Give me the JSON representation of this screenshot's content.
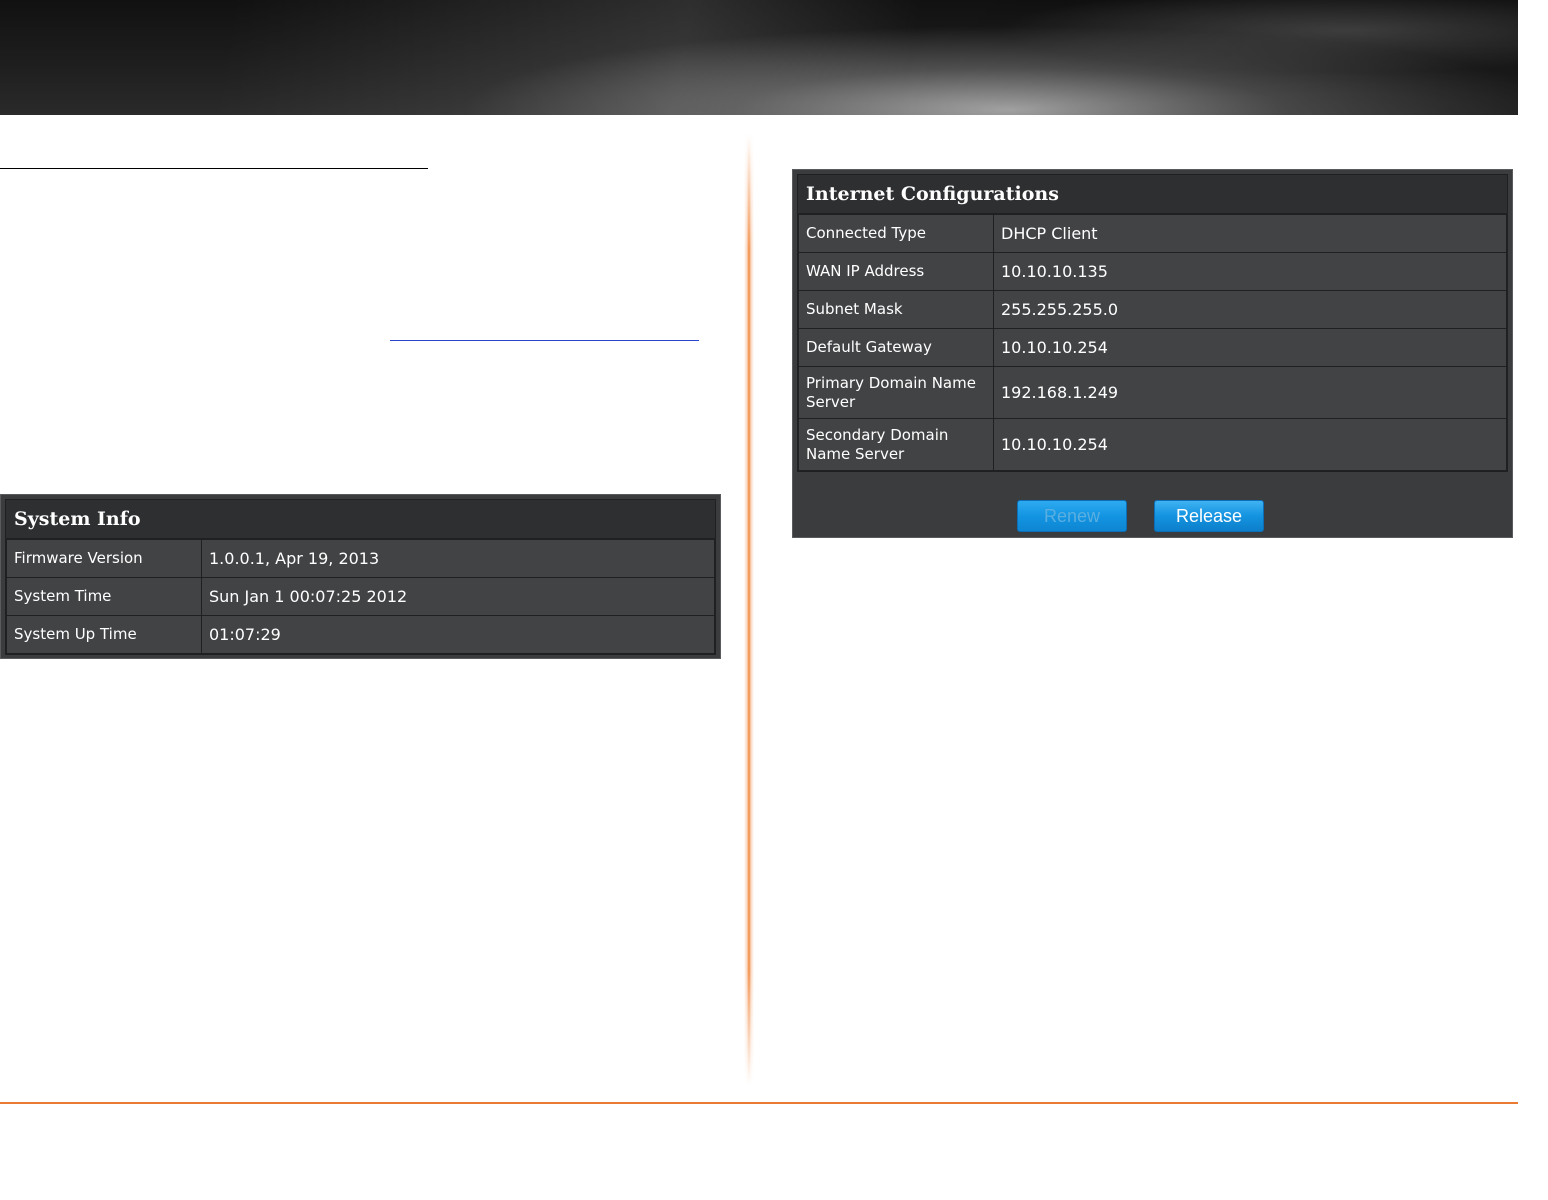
{
  "colors": {
    "accent_orange": "#e97a32",
    "panel_bg": "#3b3c3e",
    "button_blue": "#1393e0"
  },
  "system_info": {
    "title": "System Info",
    "rows": [
      {
        "label": "Firmware Version",
        "value": "1.0.0.1, Apr 19, 2013"
      },
      {
        "label": "System Time",
        "value": "Sun Jan 1 00:07:25 2012"
      },
      {
        "label": "System Up Time",
        "value": "01:07:29"
      }
    ]
  },
  "internet_config": {
    "title": "Internet Configurations",
    "rows": [
      {
        "label": "Connected Type",
        "value": "DHCP Client"
      },
      {
        "label": "WAN IP Address",
        "value": "10.10.10.135"
      },
      {
        "label": "Subnet Mask",
        "value": "255.255.255.0"
      },
      {
        "label": "Default Gateway",
        "value": "10.10.10.254"
      },
      {
        "label": "Primary Domain Name Server",
        "value": "192.168.1.249"
      },
      {
        "label": "Secondary Domain Name Server",
        "value": "10.10.10.254"
      }
    ],
    "buttons": {
      "renew_label": "Renew",
      "release_label": "Release"
    }
  }
}
